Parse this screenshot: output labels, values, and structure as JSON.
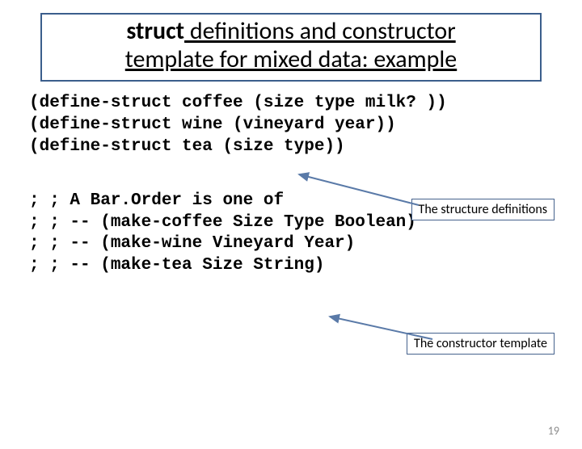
{
  "title": {
    "struct_word": "struct",
    "rest_line1": " definitions and constructor",
    "rest_line2": "template for mixed data: example"
  },
  "defs": {
    "line1": "(define-struct coffee (size type milk? ))",
    "line2": "(define-struct wine (vineyard year))",
    "line3": "(define-struct tea (size type))"
  },
  "comments": {
    "line1": "; ; A Bar.Order is one of",
    "line2": "; ; -- (make-coffee Size Type Boolean)",
    "line3": "; ; -- (make-wine Vineyard Year)",
    "line4": "; ; -- (make-tea Size String)"
  },
  "annotations": {
    "struct_defs": "The structure definitions",
    "ctor_template": "The constructor template"
  },
  "page_number": "19"
}
